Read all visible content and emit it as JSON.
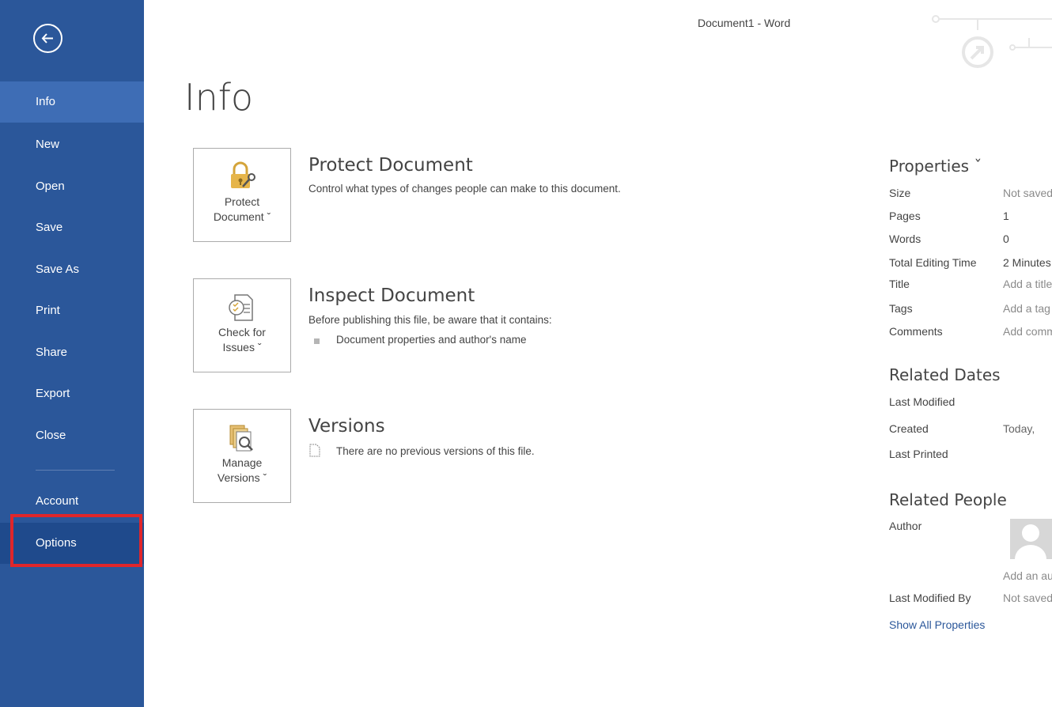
{
  "window": {
    "title": "Document1 - Word"
  },
  "sidebar": {
    "items": [
      {
        "label": "Info"
      },
      {
        "label": "New"
      },
      {
        "label": "Open"
      },
      {
        "label": "Save"
      },
      {
        "label": "Save As"
      },
      {
        "label": "Print"
      },
      {
        "label": "Share"
      },
      {
        "label": "Export"
      },
      {
        "label": "Close"
      },
      {
        "label": "Account"
      },
      {
        "label": "Options"
      }
    ],
    "highlight_color": "#e0262b",
    "background": "#2b579a"
  },
  "page_title": "Info",
  "sections": {
    "protect": {
      "tile_label_1": "Protect",
      "tile_label_2": "Document ˇ",
      "title": "Protect Document",
      "description": "Control what types of changes people can make to this document."
    },
    "inspect": {
      "tile_label_1": "Check for",
      "tile_label_2": "Issues ˇ",
      "title": "Inspect Document",
      "description": "Before publishing this file, be aware that it contains:",
      "bullets": [
        "Document properties and author's name"
      ]
    },
    "versions": {
      "tile_label_1": "Manage",
      "tile_label_2": "Versions ˇ",
      "title": "Versions",
      "description": "There are no previous versions of this file."
    }
  },
  "properties": {
    "title": "Properties ˇ",
    "rows": [
      {
        "label": "Size",
        "value": "Not saved yet"
      },
      {
        "label": "Pages",
        "value": "1"
      },
      {
        "label": "Words",
        "value": "0"
      },
      {
        "label": "Total Editing Time",
        "value": "2 Minutes"
      },
      {
        "label": "Title",
        "value": "Add a title"
      },
      {
        "label": "Tags",
        "value": "Add a tag"
      },
      {
        "label": "Comments",
        "value": "Add comments"
      }
    ],
    "related_dates": {
      "title": "Related Dates",
      "rows": [
        {
          "label": "Last Modified",
          "value": ""
        },
        {
          "label": "Created",
          "value": "Today, "
        },
        {
          "label": "Last Printed",
          "value": ""
        }
      ]
    },
    "related_people": {
      "title": "Related People",
      "author_label": "Author",
      "add_author": "Add an author",
      "last_modified_by_label": "Last Modified By",
      "last_modified_by_value": "Not saved yet"
    },
    "show_all": "Show All Properties"
  }
}
